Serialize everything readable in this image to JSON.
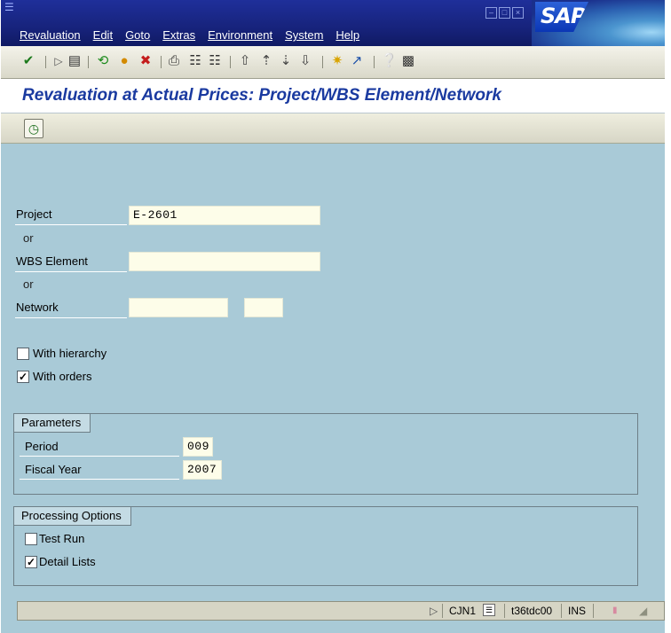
{
  "menubar": {
    "items": [
      "Revaluation",
      "Edit",
      "Goto",
      "Extras",
      "Environment",
      "System",
      "Help"
    ],
    "logo_text": "SAP"
  },
  "title": "Revaluation at Actual Prices: Project/WBS Element/Network",
  "form": {
    "project_label": "Project",
    "project_value": "E-2601",
    "or1": "or",
    "wbs_label": "WBS Element",
    "wbs_value": "",
    "or2": "or",
    "network_label": "Network",
    "network_value": "",
    "network_op_value": "",
    "with_hierarchy_label": "With hierarchy",
    "with_hierarchy_checked": false,
    "with_orders_label": "With orders",
    "with_orders_checked": true
  },
  "parameters": {
    "title": "Parameters",
    "period_label": "Period",
    "period_value": "009",
    "fiscal_year_label": "Fiscal Year",
    "fiscal_year_value": "2007"
  },
  "processing": {
    "title": "Processing Options",
    "test_run_label": "Test Run",
    "test_run_checked": false,
    "detail_lists_label": "Detail Lists",
    "detail_lists_checked": true
  },
  "statusbar": {
    "transaction": "CJN1",
    "server": "t36tdc00",
    "mode": "INS"
  },
  "colors": {
    "menubar": "#17237c",
    "content": "#a9cad7",
    "title_text": "#1a3aa0",
    "input_bg": "#fdfde9"
  }
}
